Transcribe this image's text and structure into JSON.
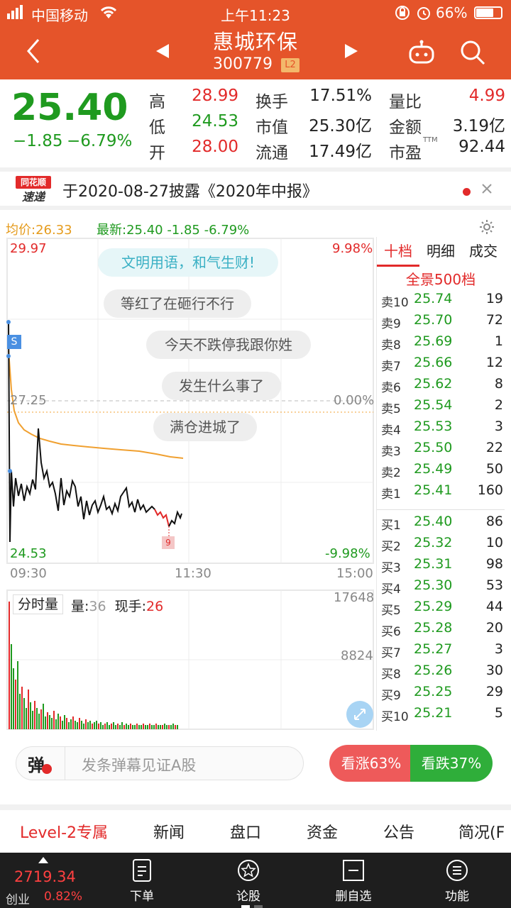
{
  "status": {
    "carrier": "中国移动",
    "time": "上午11:23",
    "battery": "66%"
  },
  "header": {
    "stock_name": "惠城环保",
    "stock_code": "300779",
    "level_badge": "L2"
  },
  "quote": {
    "price": "25.40",
    "change": "−1.85",
    "change_pct": "−6.79%",
    "rows": [
      {
        "l1": "高",
        "v1": "28.99",
        "l2": "换手",
        "v2": "17.51%",
        "l3": "量比",
        "v3": "4.99"
      },
      {
        "l1": "低",
        "v1": "24.53",
        "l2": "市值",
        "v2": "25.30亿",
        "l3": "金额",
        "v3": "3.19亿"
      },
      {
        "l1": "开",
        "v1": "28.00",
        "l2": "流通",
        "v2": "17.49亿",
        "l3": "市盈",
        "v3": "92.44"
      }
    ],
    "pe_sup": "TTM"
  },
  "news": {
    "logo_top": "同花顺",
    "logo_bottom": "速递",
    "text": "于2020-08-27披露《2020年中报》"
  },
  "chart": {
    "avg_label": "均价:26.33",
    "latest_label": "最新:25.40 -1.85 -6.79%",
    "top_price": "29.97",
    "top_pct": "9.98%",
    "mid_price": "27.25",
    "mid_pct": "0.00%",
    "bottom_price": "24.53",
    "bottom_pct": "-9.98%",
    "time_start": "09:30",
    "time_mid": "11:30",
    "time_end": "15:00",
    "marker_s": "S",
    "marker_9": "9",
    "bubbles": [
      "文明用语，和气生财!",
      "等红了在砸行不行",
      "今天不跌停我跟你姓",
      "发生什么事了",
      "满仓进城了"
    ],
    "vol_label": "分时量",
    "vol_text": "量:",
    "vol_value": "36",
    "hand_text": "现手:",
    "hand_value": "26",
    "vol_top": "17648",
    "vol_mid": "8824"
  },
  "orderbook": {
    "tabs": [
      "十档",
      "明细",
      "成交"
    ],
    "title": "全景500档",
    "asks": [
      {
        "label": "卖10",
        "price": "25.74",
        "qty": "19"
      },
      {
        "label": "卖9",
        "price": "25.70",
        "qty": "72"
      },
      {
        "label": "卖8",
        "price": "25.69",
        "qty": "1"
      },
      {
        "label": "卖7",
        "price": "25.66",
        "qty": "12"
      },
      {
        "label": "卖6",
        "price": "25.62",
        "qty": "8"
      },
      {
        "label": "卖5",
        "price": "25.54",
        "qty": "2"
      },
      {
        "label": "卖4",
        "price": "25.53",
        "qty": "3"
      },
      {
        "label": "卖3",
        "price": "25.50",
        "qty": "22"
      },
      {
        "label": "卖2",
        "price": "25.49",
        "qty": "50"
      },
      {
        "label": "卖1",
        "price": "25.41",
        "qty": "160"
      }
    ],
    "bids": [
      {
        "label": "买1",
        "price": "25.40",
        "qty": "86"
      },
      {
        "label": "买2",
        "price": "25.32",
        "qty": "10"
      },
      {
        "label": "买3",
        "price": "25.31",
        "qty": "98"
      },
      {
        "label": "买4",
        "price": "25.30",
        "qty": "53"
      },
      {
        "label": "买5",
        "price": "25.29",
        "qty": "44"
      },
      {
        "label": "买6",
        "price": "25.28",
        "qty": "20"
      },
      {
        "label": "买7",
        "price": "25.27",
        "qty": "3"
      },
      {
        "label": "买8",
        "price": "25.26",
        "qty": "30"
      },
      {
        "label": "买9",
        "price": "25.25",
        "qty": "29"
      },
      {
        "label": "买10",
        "price": "25.21",
        "qty": "5"
      }
    ]
  },
  "danmu": {
    "icon_char": "弹",
    "placeholder": "发条弹幕见证A股",
    "up_label": "看涨63%",
    "down_label": "看跌37%"
  },
  "tabs": [
    "Level-2专属",
    "新闻",
    "盘口",
    "资金",
    "公告",
    "简况(F"
  ],
  "bottombar": {
    "index_value": "2719.34",
    "index_name": "创业",
    "index_pct": "0.82%",
    "items": [
      "下单",
      "论股",
      "删自选",
      "功能"
    ]
  },
  "colors": {
    "brand": "#e5542a",
    "up": "#e22a2a",
    "down": "#1f9a1f",
    "avg_line": "#f0a030"
  }
}
